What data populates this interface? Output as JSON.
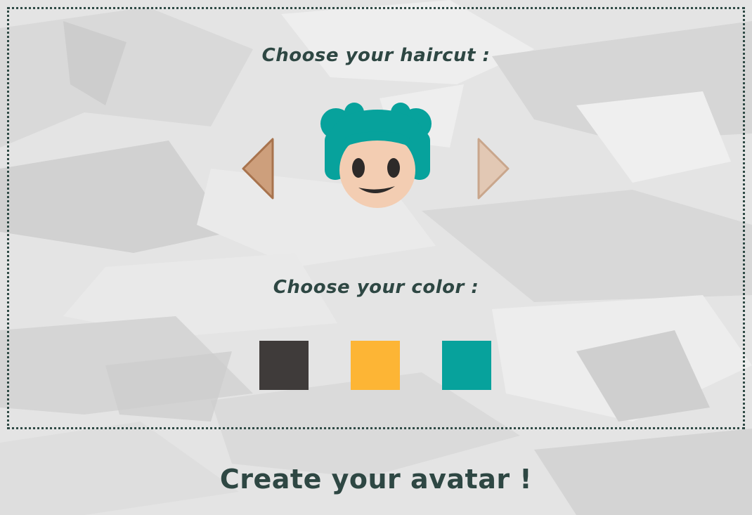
{
  "haircut_section": {
    "heading": "Choose your haircut :"
  },
  "color_section": {
    "heading": "Choose your color :",
    "swatches": [
      {
        "name": "dark-gray",
        "hex": "#3f3b3a"
      },
      {
        "name": "yellow",
        "hex": "#fdb535"
      },
      {
        "name": "teal",
        "hex": "#07a29c"
      }
    ]
  },
  "cta": {
    "label": "Create your avatar !"
  },
  "avatar": {
    "hair_color": "#07a29c",
    "skin_color": "#f3cdb2",
    "feature_color": "#2d2a29"
  },
  "colors": {
    "arrow_left_fill": "#cd9f7c",
    "arrow_left_stroke": "#a8734d",
    "arrow_right_fill": "#e2c8b4",
    "arrow_right_stroke": "#c9a68c",
    "text": "#2e4743",
    "frame": "#2f4a45"
  },
  "icons": {
    "prev": "triangle-left-icon",
    "next": "triangle-right-icon"
  }
}
